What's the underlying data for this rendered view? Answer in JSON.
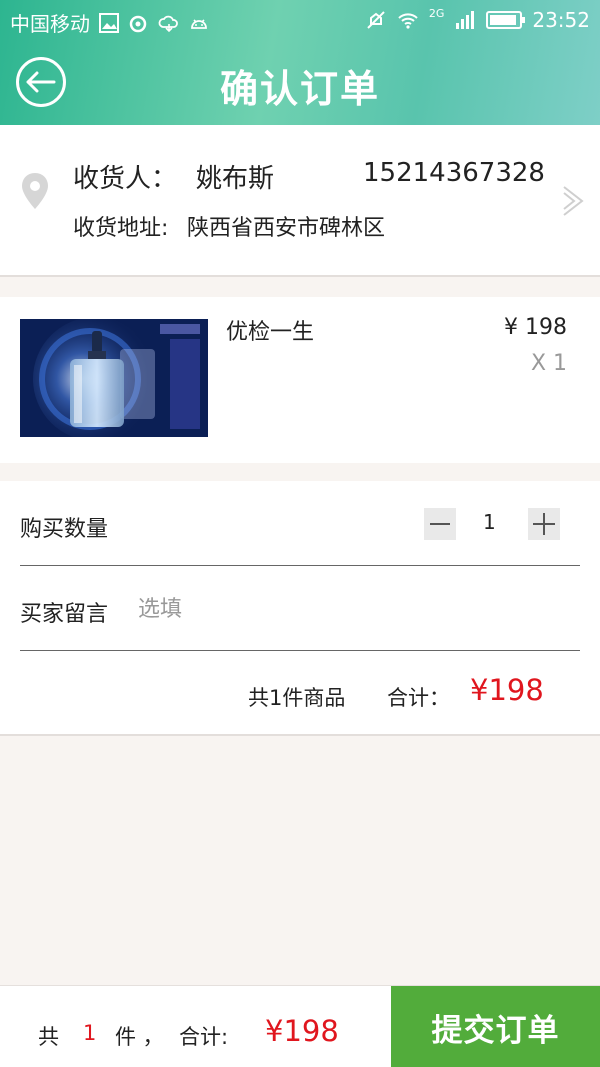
{
  "status_bar": {
    "carrier": "中国移动",
    "network": "2G",
    "time": "23:52",
    "icons": [
      "image-icon",
      "weibo-icon",
      "cloud-icon",
      "android-icon",
      "mute-icon",
      "wifi-icon",
      "signal-icon",
      "battery-icon"
    ]
  },
  "header": {
    "title": "确认订单",
    "back_icon": "back-arrow-icon"
  },
  "address": {
    "receiver_label": "收货人：",
    "receiver_name": "姚布斯",
    "phone": "15214367328",
    "address_label": "收货地址:",
    "address_value": "陕西省西安市碑林区",
    "location_icon": "location-pin-icon",
    "chevron_icon": "chevron-right-icon"
  },
  "product": {
    "name": "优检一生",
    "price": "¥ 198",
    "quantity": "X 1"
  },
  "order": {
    "quantity_label": "购买数量",
    "quantity_value": "1",
    "minus_label": "—",
    "plus_label": "+",
    "message_label": "买家留言",
    "message_placeholder": "选填",
    "summary_count": "共1件商品",
    "summary_label": "合计：",
    "summary_amount": "¥198"
  },
  "bottom_bar": {
    "prefix": "共",
    "count": "1",
    "unit": "件 ，",
    "total_label": "合计:",
    "total_amount": "¥198",
    "submit_label": "提交订单"
  },
  "colors": {
    "header_gradient_start": "#2db590",
    "price_red": "#e0161e",
    "submit_green": "#52ac3b",
    "page_background": "#f8f4f1"
  }
}
